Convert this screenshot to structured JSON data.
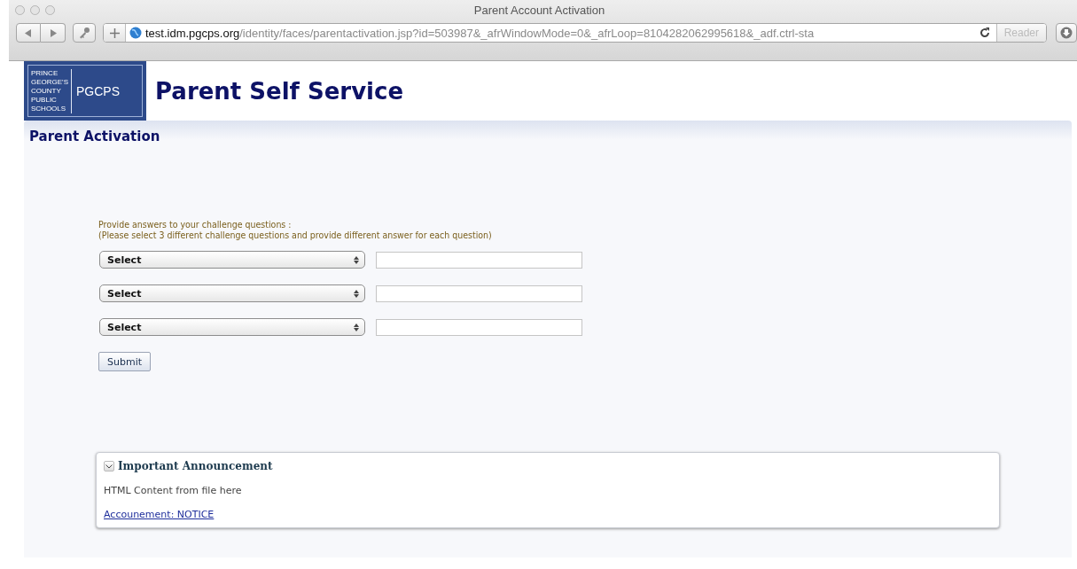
{
  "window": {
    "title": "Parent Account Activation"
  },
  "toolbar": {
    "url_host": "test.idm.pgcps.org",
    "url_path": "/identity/faces/parentactivation.jsp?id=503987&_afrWindowMode=0&_afrLoop=8104282062995618&_adf.ctrl-sta",
    "reader": "Reader"
  },
  "header": {
    "logo_small": [
      "PRINCE",
      "GEORGE'S",
      "COUNTY",
      "PUBLIC",
      "SCHOOLS"
    ],
    "logo_big": "PGCPS",
    "title": "Parent Self Service"
  },
  "section_title": "Parent Activation",
  "form": {
    "instructions": [
      "Provide answers to your challenge questions :",
      "(Please select 3 different challenge questions and provide different answer for each question)"
    ],
    "rows": [
      {
        "question": "Select"
      },
      {
        "question": "Select"
      },
      {
        "question": "Select"
      }
    ],
    "submit": "Submit"
  },
  "announcement": {
    "title": "Important Announcement",
    "expanded": true,
    "body": "HTML Content from file here",
    "link": "Accounement: NOTICE"
  }
}
